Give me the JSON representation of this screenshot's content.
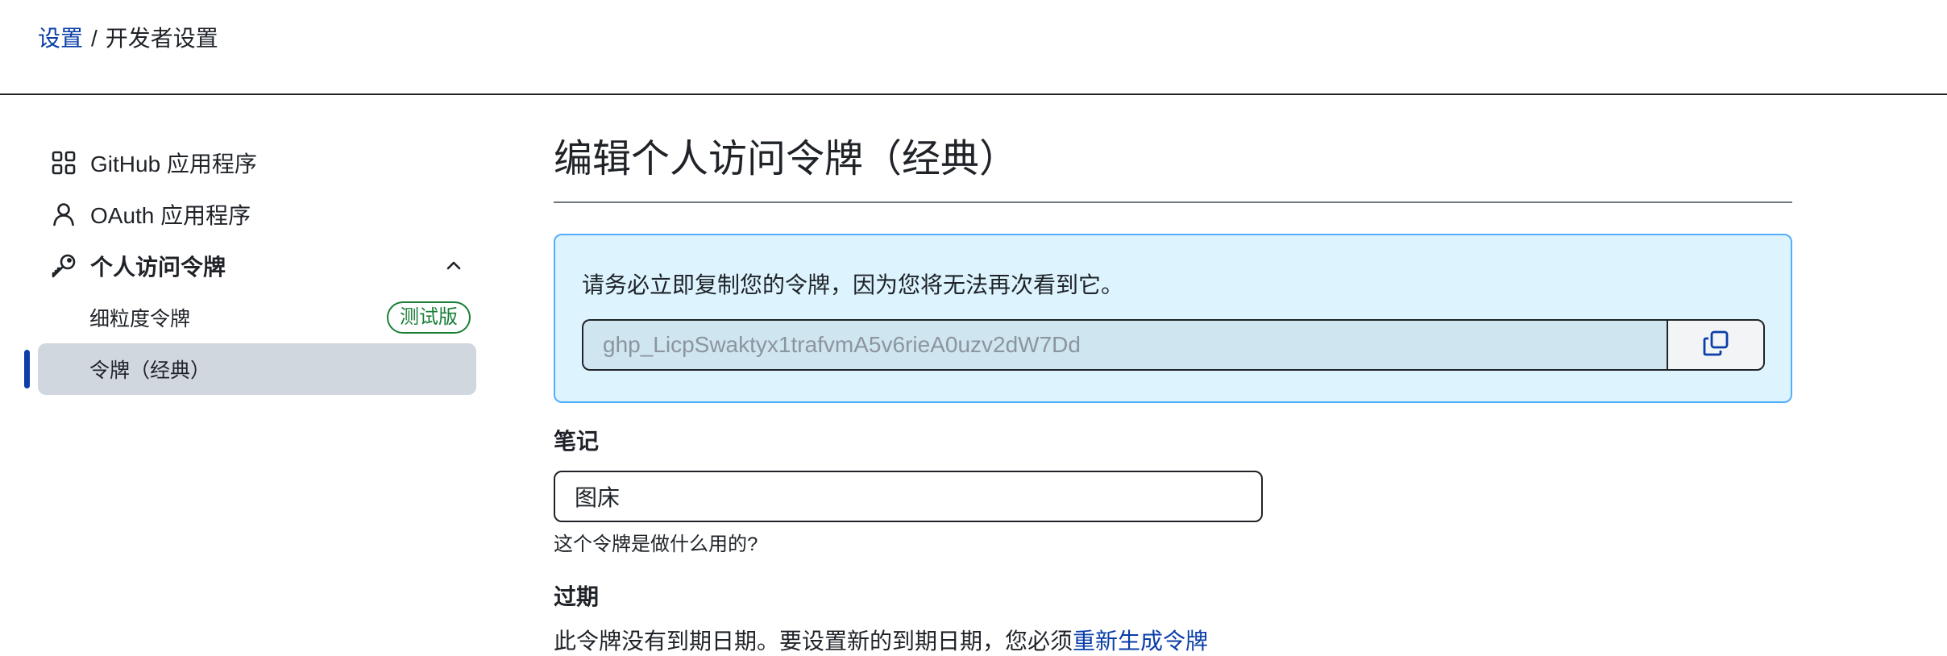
{
  "breadcrumb": {
    "parent": "设置",
    "separator": "/",
    "current": "开发者设置"
  },
  "sidebar": {
    "items": [
      {
        "label": "GitHub 应用程序",
        "icon": "apps-grid-icon"
      },
      {
        "label": "OAuth 应用程序",
        "icon": "person-icon"
      },
      {
        "label": "个人访问令牌",
        "icon": "key-icon",
        "expanded": true
      }
    ],
    "sub_items": [
      {
        "label": "细粒度令牌",
        "badge": "测试版"
      },
      {
        "label": "令牌（经典）",
        "selected": true
      }
    ]
  },
  "main": {
    "title": "编辑个人访问令牌（经典）",
    "flash": {
      "message": "请务必立即复制您的令牌，因为您将无法再次看到它。",
      "token": "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"
    },
    "note": {
      "label": "笔记",
      "value": "图床",
      "hint": "这个令牌是做什么用的?"
    },
    "expiration": {
      "label": "过期",
      "text": "此令牌没有到期日期。要设置新的到期日期，您必须",
      "link": "重新生成令牌"
    }
  },
  "colors": {
    "link": "#0a3ea8",
    "flash_bg": "#ddf4ff",
    "flash_border": "#54aeff",
    "beta_green": "#1a7f37",
    "selected_bg": "#d0d7de"
  }
}
